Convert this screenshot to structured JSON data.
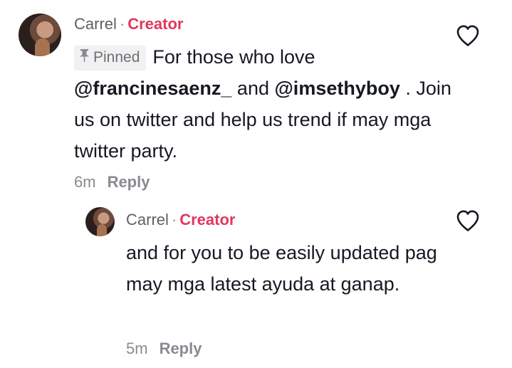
{
  "comments": [
    {
      "username": "Carrel",
      "separator": "·",
      "role": "Creator",
      "pinned_label": "Pinned",
      "text_parts": {
        "intro": "For those who love ",
        "mention1": "@francinesaenz_",
        "joiner": " and ",
        "mention2": "@imsethyboy",
        "rest": " . Join us on twitter and help us trend if may mga twitter party."
      },
      "time": "6m",
      "reply_label": "Reply",
      "icons": {
        "avatar": "avatar",
        "pin": "pin-icon",
        "like": "heart-icon"
      }
    },
    {
      "username": "Carrel",
      "separator": "·",
      "role": "Creator",
      "text": "and for you to be easily updated pag may mga latest ayuda at ganap.",
      "time": "5m",
      "reply_label": "Reply",
      "icons": {
        "avatar": "avatar",
        "like": "heart-icon"
      }
    }
  ],
  "colors": {
    "creator": "#e1375f",
    "text": "#161823",
    "muted": "#8a8b91",
    "pinned_bg": "#f1f1f2"
  }
}
